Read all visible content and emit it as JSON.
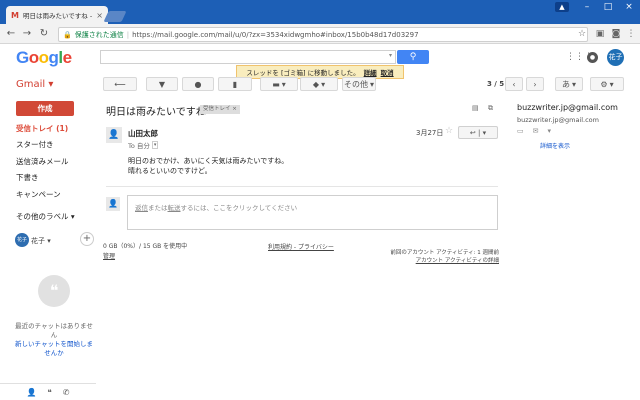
{
  "browser": {
    "tab_title": "明日は雨みたいですね - ...",
    "secure_label": "保護された通信",
    "url": "https://mail.google.com/mail/u/0/?zx=3534xidwgmho#inbox/15b0b48d17d03297"
  },
  "gmail": {
    "logo": "Google",
    "app_label": "Gmail",
    "avatar_initials": "花子"
  },
  "toast": {
    "message": "スレッドを [ゴミ箱] に移動しました。",
    "details": "詳細",
    "undo": "取消"
  },
  "toolbar": {
    "more_label": "その他",
    "pager": "3 / 5",
    "lang_label": "あ"
  },
  "sidebar": {
    "compose": "作成",
    "items": [
      {
        "label": "受信トレイ (1)"
      },
      {
        "label": "スター付き"
      },
      {
        "label": "送信済みメール"
      },
      {
        "label": "下書き"
      },
      {
        "label": "キャンペーン"
      },
      {
        "label": "その他のラベル"
      }
    ],
    "hangout_name": "花子",
    "chat_empty": "最近のチャットはありません",
    "chat_start": "新しいチャットを開始しませんか"
  },
  "message": {
    "subject": "明日は雨みたいですね",
    "label_chip": "受信トレイ",
    "sender": "山田太郎",
    "to": "To 自分",
    "date": "3月27日",
    "body": [
      "明日のおでかけ、あいにく天気は雨みたいですね。",
      "晴れるといいのですけど。"
    ],
    "reply_prompt_pre": "",
    "reply_link1": "返信",
    "reply_mid": "または",
    "reply_link2": "転送",
    "reply_post": "するには、ここをクリックしてください"
  },
  "footer": {
    "storage": "0 GB（0%）/ 15 GB を使用中",
    "manage": "管理",
    "terms": "利用規約",
    "privacy": "プライバシー",
    "last_activity": "前回のアカウント アクティビティ: 1 週間前",
    "activity_details": "アカウント アクティビティの詳細"
  },
  "contact": {
    "name": "buzzwriter.jp@gmail.com",
    "email": "buzzwriter.jp@gmail.com",
    "details": "詳細を表示"
  }
}
